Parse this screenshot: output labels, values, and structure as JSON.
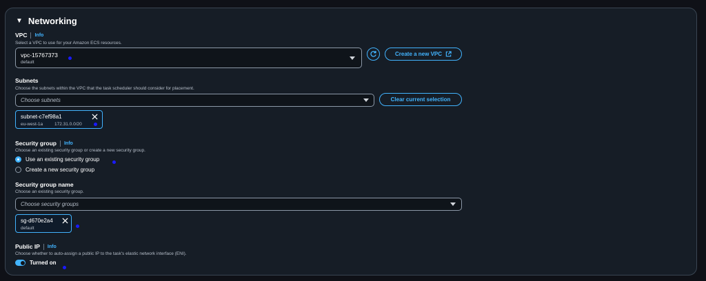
{
  "section": {
    "title": "Networking",
    "caret_icon": "caret-down-icon"
  },
  "vpc": {
    "label": "VPC",
    "info": "Info",
    "description": "Select a VPC to use for your Amazon ECS resources.",
    "selected": "vpc-15767373",
    "selected_sub": "default",
    "create_button": "Create a new VPC"
  },
  "subnets": {
    "label": "Subnets",
    "description": "Choose the subnets within the VPC that the task scheduler should consider for placement.",
    "placeholder": "Choose subnets",
    "clear_button": "Clear current selection",
    "tokens": [
      {
        "name": "subnet-c7ef98a1",
        "zone": "eu-west-1a",
        "cidr": "172.31.0.0/20"
      }
    ]
  },
  "security_group": {
    "label": "Security group",
    "info": "Info",
    "description": "Choose an existing security group or create a new security group.",
    "options": [
      {
        "label": "Use an existing security group",
        "selected": true
      },
      {
        "label": "Create a new security group",
        "selected": false
      }
    ]
  },
  "security_group_name": {
    "label": "Security group name",
    "description": "Choose an existing security group.",
    "placeholder": "Choose security groups",
    "tokens": [
      {
        "name": "sg-d670e2a4",
        "sub": "default"
      }
    ]
  },
  "public_ip": {
    "label": "Public IP",
    "info": "Info",
    "description": "Choose whether to auto-assign a public IP to the task's elastic network interface (ENI).",
    "toggle_label": "Turned on",
    "enabled": true
  },
  "colors": {
    "accent": "#42b4ff",
    "panel": "#161d26",
    "background": "#0f1117",
    "marker": "#1a1aff"
  }
}
